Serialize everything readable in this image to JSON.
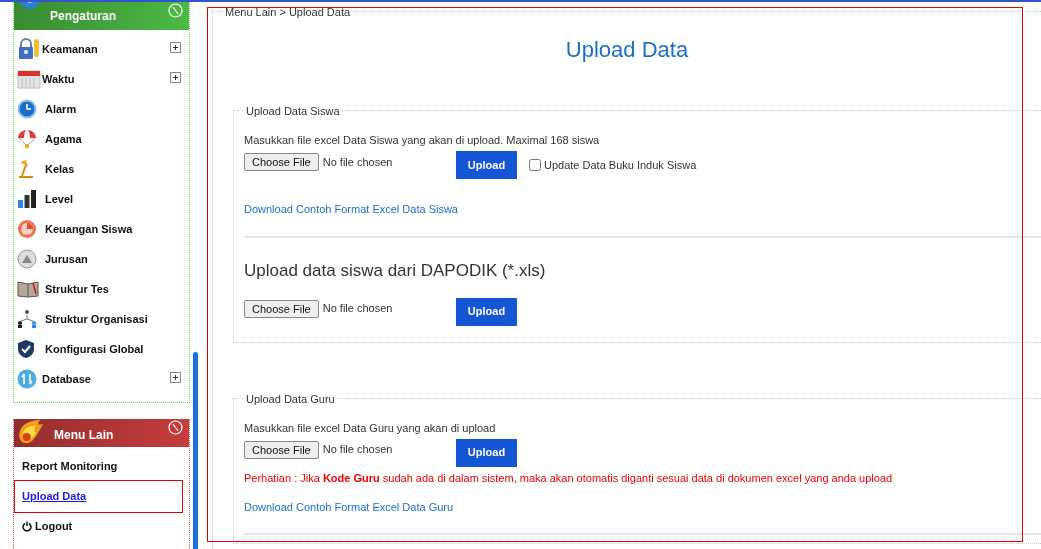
{
  "sidebar": {
    "sections": [
      {
        "title": "Pengaturan",
        "color": "#4cb944",
        "items": [
          {
            "label": "Keamanan",
            "kind": "group"
          },
          {
            "label": "Waktu",
            "kind": "group"
          },
          {
            "label": "Alarm",
            "kind": "link"
          },
          {
            "label": "Agama",
            "kind": "link"
          },
          {
            "label": "Kelas",
            "kind": "link"
          },
          {
            "label": "Level",
            "kind": "link"
          },
          {
            "label": "Keuangan Siswa",
            "kind": "link"
          },
          {
            "label": "Jurusan",
            "kind": "link"
          },
          {
            "label": "Struktur Tes",
            "kind": "link"
          },
          {
            "label": "Struktur Organisasi",
            "kind": "link"
          },
          {
            "label": "Konfigurasi Global",
            "kind": "link"
          },
          {
            "label": "Database",
            "kind": "group"
          }
        ]
      },
      {
        "title": "Menu Lain",
        "color": "#c63c3c",
        "items": [
          {
            "label": "Report Monitoring",
            "kind": "link",
            "selected": false
          },
          {
            "label": "Upload Data",
            "kind": "link",
            "selected": true
          },
          {
            "label": "Logout",
            "kind": "logout",
            "selected": false
          }
        ]
      }
    ]
  },
  "breadcrumb": "Menu Lain > Upload Data",
  "title": "Upload Data",
  "fieldsets": [
    {
      "legend": "Upload Data Siswa",
      "blocks": [
        {
          "kind": "instruction",
          "text": "Masukkan file excel Data Siswa yang akan di upload. Maximal 168 siswa"
        },
        {
          "kind": "upload_row",
          "choose": "Choose File",
          "status": "No file chosen",
          "button": "Upload",
          "checkbox": {
            "label": "Update Data Buku Induk Siswa",
            "checked": false
          }
        },
        {
          "kind": "link",
          "text": "Download Contoh Format Excel Data Siswa"
        },
        {
          "kind": "heading",
          "text": "Upload data siswa dari DAPODIK (*.xls)"
        },
        {
          "kind": "upload_row",
          "choose": "Choose File",
          "status": "No file chosen",
          "button": "Upload"
        }
      ]
    },
    {
      "legend": "Upload Data Guru",
      "blocks": [
        {
          "kind": "instruction",
          "text": "Masukkan file excel Data Guru yang akan di upload"
        },
        {
          "kind": "upload_row",
          "choose": "Choose File",
          "status": "No file chosen",
          "button": "Upload"
        },
        {
          "kind": "warning",
          "text": "Perhatian : Jika **Kode Guru** sudah ada di dalam sistem, maka akan otomatis diganti sesuai data di dokumen excel yang anda upload"
        },
        {
          "kind": "link",
          "text": "Download Contoh Format Excel Data Guru"
        }
      ]
    }
  ]
}
